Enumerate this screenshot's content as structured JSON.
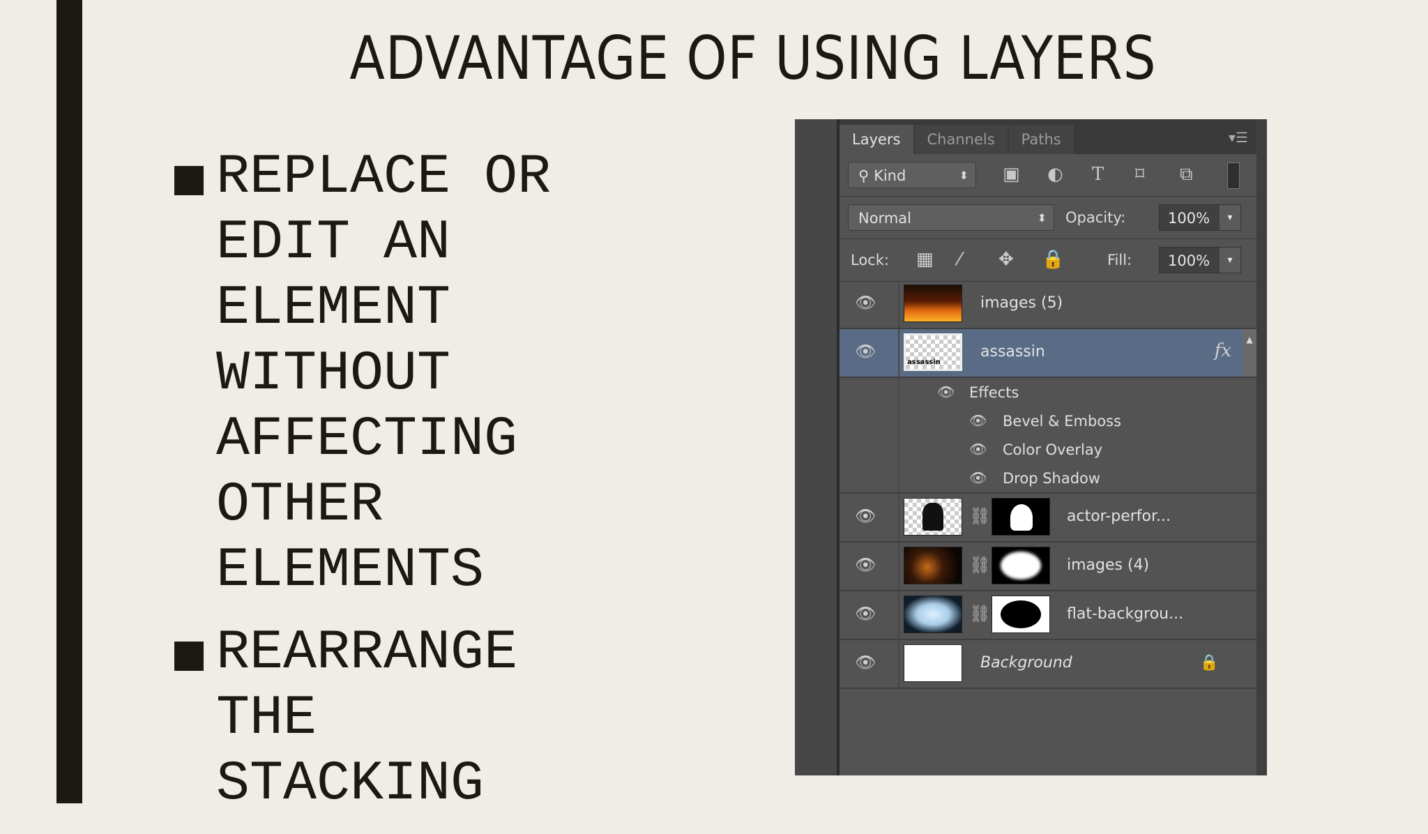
{
  "slide": {
    "title": "ADVANTAGE OF USING LAYERS",
    "bullets": [
      "REPLACE OR\nEDIT AN\nELEMENT\nWITHOUT\nAFFECTING\nOTHER\nELEMENTS",
      "REARRANGE\nTHE\nSTACKING"
    ]
  },
  "panel": {
    "tabs": [
      "Layers",
      "Channels",
      "Paths"
    ],
    "active_tab": "Layers",
    "filter": {
      "kind_label": "Kind",
      "icons": [
        "image-filter-icon",
        "adjustment-filter-icon",
        "type-filter-icon",
        "shape-filter-icon",
        "smart-object-filter-icon"
      ]
    },
    "blend_mode": "Normal",
    "opacity_label": "Opacity:",
    "opacity_value": "100%",
    "lock_label": "Lock:",
    "fill_label": "Fill:",
    "fill_value": "100%",
    "layers": [
      {
        "name": "images (5)"
      },
      {
        "name": "assassin",
        "fx": "fx",
        "selected": true,
        "thumb_text": "assassin"
      },
      {
        "name": "actor-perfor..."
      },
      {
        "name": "images (4)"
      },
      {
        "name": "flat-backgrou..."
      },
      {
        "name": "Background"
      }
    ],
    "effects_label": "Effects",
    "effects": [
      "Bevel & Emboss",
      "Color Overlay",
      "Drop Shadow"
    ]
  }
}
